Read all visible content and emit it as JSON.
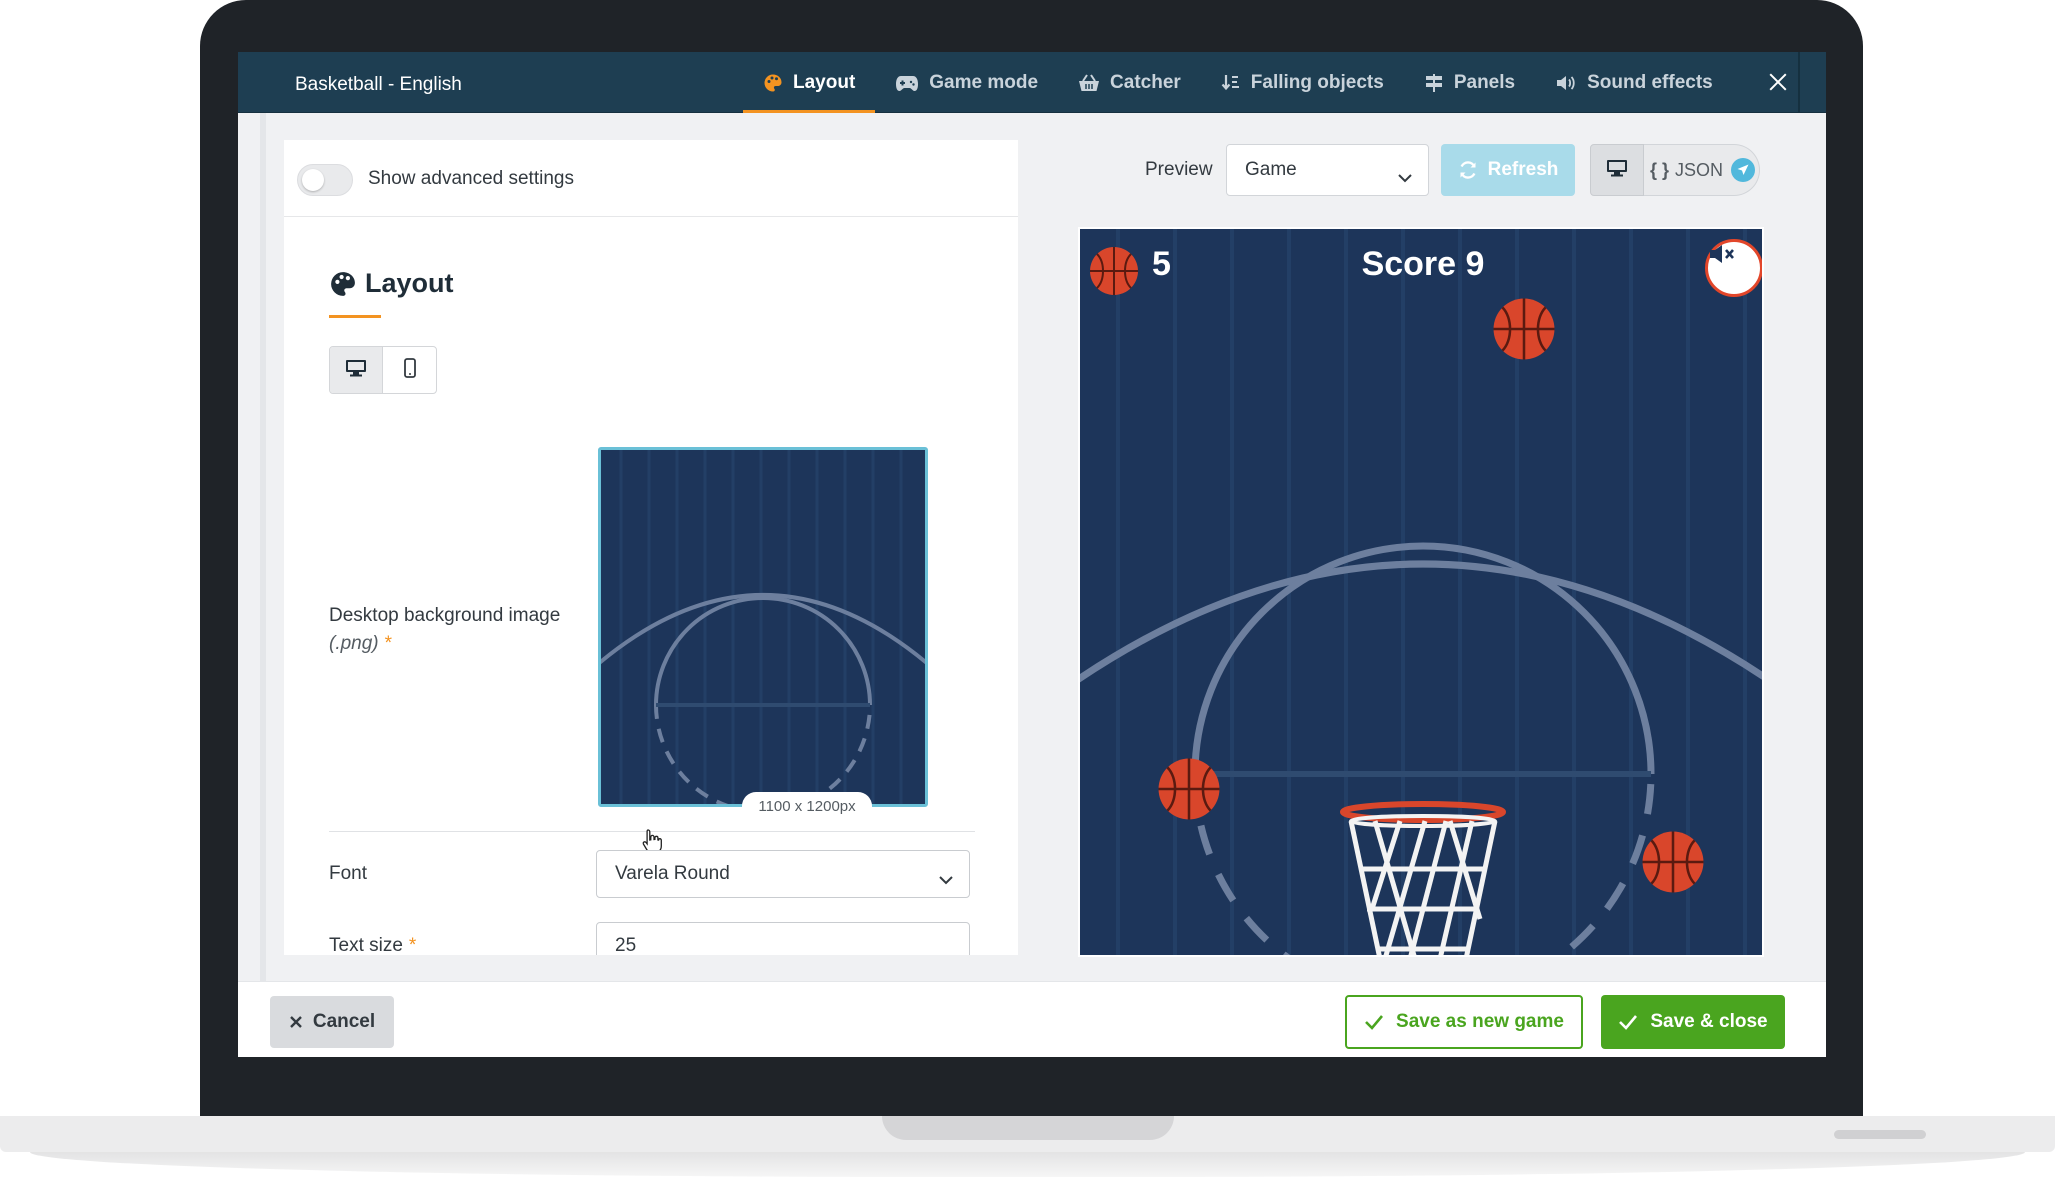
{
  "app": {
    "title": "Basketball - English"
  },
  "tabs": [
    {
      "label": "Layout",
      "icon": "palette-icon",
      "active": true
    },
    {
      "label": "Game mode",
      "icon": "gamepad-icon"
    },
    {
      "label": "Catcher",
      "icon": "basket-icon"
    },
    {
      "label": "Falling objects",
      "icon": "sort-down-icon"
    },
    {
      "label": "Panels",
      "icon": "signpost-icon"
    },
    {
      "label": "Sound effects",
      "icon": "volume-icon"
    }
  ],
  "settings": {
    "advanced_toggle_label": "Show advanced settings",
    "advanced_toggle_on": false,
    "section_title": "Layout",
    "background": {
      "label": "Desktop background image",
      "hint": "(.png)",
      "required_mark": "*",
      "dimensions": "1100 x 1200px"
    },
    "font": {
      "label": "Font",
      "value": "Varela Round"
    },
    "text_size": {
      "label": "Text size",
      "required_mark": "*",
      "value": "25"
    }
  },
  "preview": {
    "label": "Preview",
    "mode": "Game",
    "refresh_label": "Refresh",
    "json_label": "JSON",
    "game": {
      "lives": "5",
      "score": "Score 9"
    }
  },
  "footer": {
    "cancel_label": "Cancel",
    "save_new_label": "Save as new game",
    "save_close_label": "Save & close"
  },
  "colors": {
    "topbar": "#1e3e52",
    "accent": "#f39321",
    "court": "#1d355a",
    "success": "#4aa51f",
    "refresh": "#a9dbea",
    "ball": "#d9462b"
  }
}
